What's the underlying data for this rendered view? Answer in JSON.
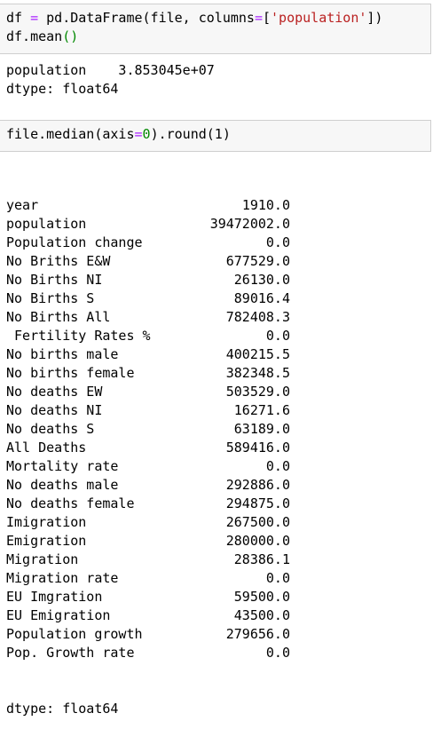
{
  "cell1": {
    "line1": {
      "var": "df",
      "eq": "=",
      "call": " pd.DataFrame(file, columns",
      "eq2": "=",
      "lb": "[",
      "str": "'population'",
      "rb": "])"
    },
    "line2": {
      "text": "df.mean",
      "paren": "()"
    }
  },
  "output1": {
    "line1": "population    3.853045e+07",
    "line2": "dtype: float64"
  },
  "cell2": {
    "pre": "file.median(axis",
    "eq": "=",
    "zero": "0",
    "post": ").round(1)"
  },
  "output2": {
    "rows": [
      {
        "label": "year",
        "value": "1910.0"
      },
      {
        "label": "population",
        "value": "39472002.0"
      },
      {
        "label": "Population change",
        "value": "0.0"
      },
      {
        "label": "No Briths E&W",
        "value": "677529.0"
      },
      {
        "label": "No Births NI",
        "value": "26130.0"
      },
      {
        "label": "No Births S",
        "value": "89016.4"
      },
      {
        "label": "No Births All",
        "value": "782408.3"
      },
      {
        "label": " Fertility Rates %",
        "value": "0.0"
      },
      {
        "label": "No births male",
        "value": "400215.5"
      },
      {
        "label": "No births female",
        "value": "382348.5"
      },
      {
        "label": "No deaths EW",
        "value": "503529.0"
      },
      {
        "label": "No deaths NI",
        "value": "16271.6"
      },
      {
        "label": "No deaths S",
        "value": "63189.0"
      },
      {
        "label": "All Deaths",
        "value": "589416.0"
      },
      {
        "label": "Mortality rate",
        "value": "0.0"
      },
      {
        "label": "No deaths male",
        "value": "292886.0"
      },
      {
        "label": "No deaths female",
        "value": "294875.0"
      },
      {
        "label": "Imigration",
        "value": "267500.0"
      },
      {
        "label": "Emigration",
        "value": "280000.0"
      },
      {
        "label": "Migration",
        "value": "28386.1"
      },
      {
        "label": "Migration rate",
        "value": "0.0"
      },
      {
        "label": "EU Imgration",
        "value": "59500.0"
      },
      {
        "label": "EU Emigration",
        "value": "43500.0"
      },
      {
        "label": "Population growth",
        "value": "279656.0"
      },
      {
        "label": "Pop. Growth rate",
        "value": "0.0"
      }
    ],
    "dtype": "dtype: float64"
  }
}
